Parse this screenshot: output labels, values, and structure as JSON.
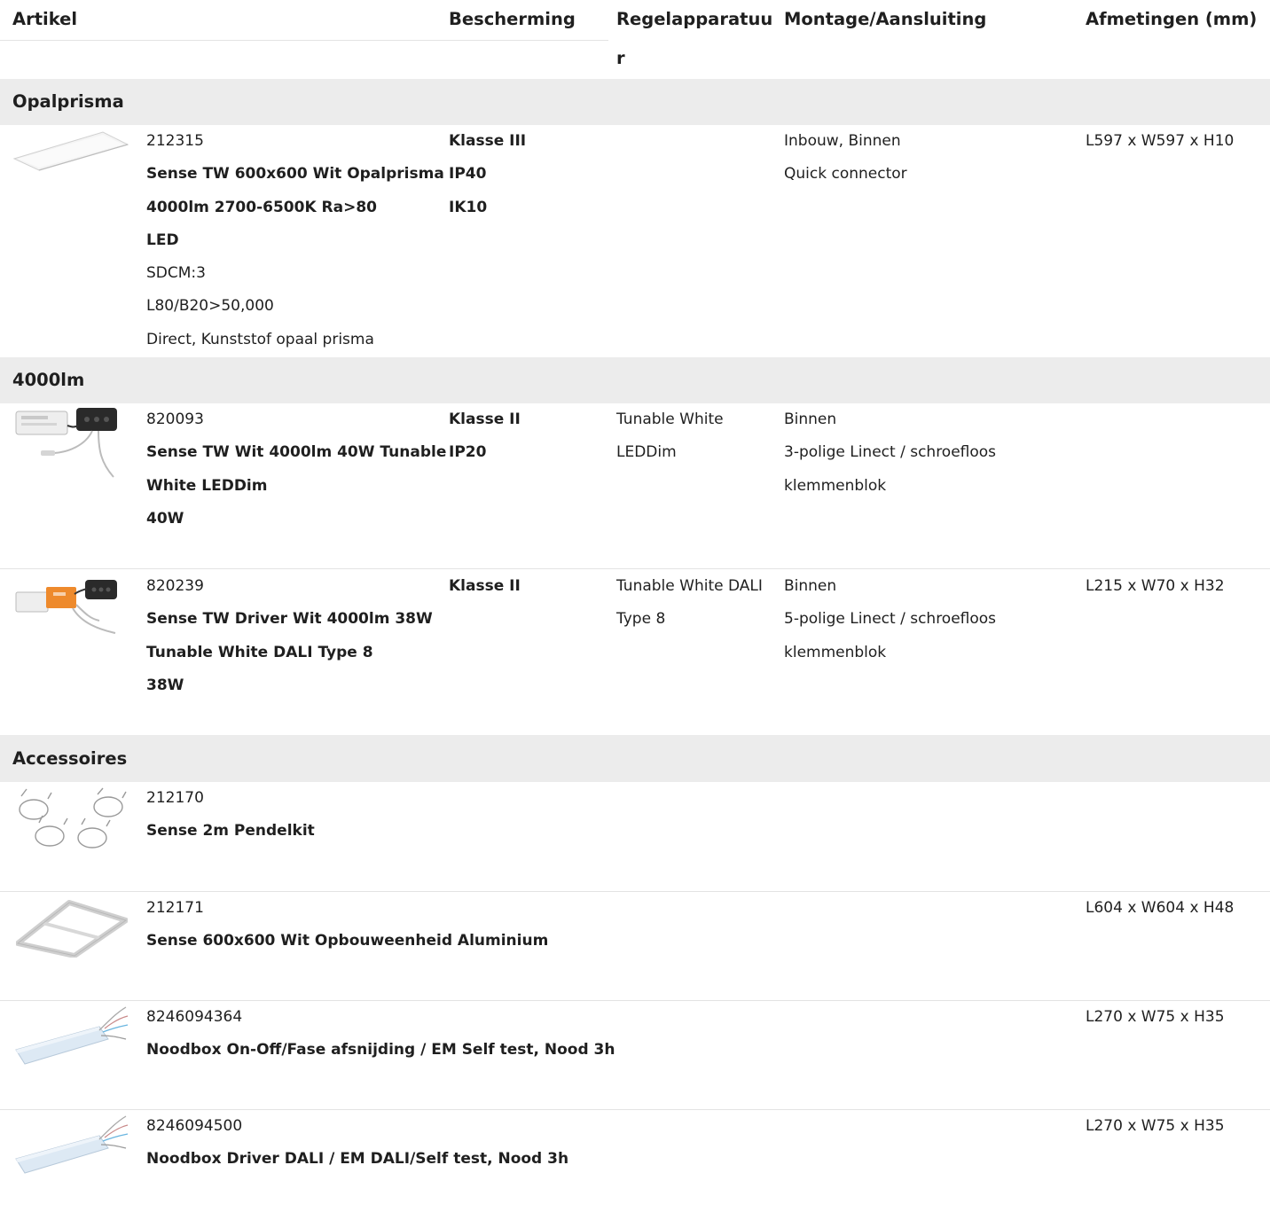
{
  "headers": {
    "artikel": "Artikel",
    "bescherming": "Bescherming",
    "regel_a": "Regelapparatuu",
    "regel_b": "r",
    "montage": "Montage/Aansluiting",
    "afmetingen": "Afmetingen (mm)"
  },
  "sections": {
    "opal": "Opalprisma",
    "lm": "4000lm",
    "acc": "Accessoires"
  },
  "products": [
    {
      "id": "212315",
      "lines": [
        "Sense TW 600x600 Wit Opalprisma",
        "4000lm 2700-6500K Ra>80",
        "LED"
      ],
      "extra": [
        "SDCM:3",
        "L80/B20>50,000",
        "Direct, Kunststof opaal prisma"
      ],
      "bescherming": [
        "Klasse III",
        "IP40",
        "IK10"
      ],
      "regel": [],
      "montage": [
        "Inbouw, Binnen",
        "Quick connector"
      ],
      "afmetingen": "L597 x W597 x H10",
      "icon": "panel-icon"
    },
    {
      "id": "820093",
      "lines": [
        "Sense TW Wit 4000lm 40W Tunable",
        "White LEDDim",
        "40W"
      ],
      "extra": [],
      "bescherming": [
        "Klasse II",
        "IP20"
      ],
      "regel": [
        "Tunable White",
        "LEDDim"
      ],
      "montage": [
        "Binnen",
        "3-polige Linect / schroefloos",
        "klemmenblok"
      ],
      "afmetingen": "",
      "icon": "driver-icon"
    },
    {
      "id": "820239",
      "lines": [
        "Sense TW Driver Wit 4000lm 38W",
        "Tunable White DALI Type 8",
        "38W"
      ],
      "extra": [],
      "bescherming": [
        "Klasse II"
      ],
      "regel": [
        "Tunable White DALI",
        "Type 8"
      ],
      "montage": [
        "Binnen",
        "5-polige Linect / schroefloos",
        "klemmenblok"
      ],
      "afmetingen": "L215 x W70 x H32",
      "icon": "dali-driver-icon"
    }
  ],
  "accessories": [
    {
      "id": "212170",
      "name": "Sense 2m Pendelkit",
      "afmetingen": "",
      "icon": "pendel-kit-icon"
    },
    {
      "id": "212171",
      "name": "Sense 600x600 Wit Opbouweenheid Aluminium",
      "afmetingen": "L604 x W604 x H48",
      "icon": "frame-icon"
    },
    {
      "id": "8246094364",
      "name": "Noodbox On-Off/Fase afsnijding / EM Self test, Nood 3h",
      "afmetingen": "L270 x W75 x H35",
      "icon": "emergency-box-icon"
    },
    {
      "id": "8246094500",
      "name": "Noodbox Driver DALI / EM DALI/Self test, Nood 3h",
      "afmetingen": "L270 x W75 x H35",
      "icon": "emergency-box-icon"
    }
  ],
  "colors": {
    "band": "#ececec",
    "divider": "#e3e3e3",
    "text": "#1f1f1f"
  }
}
